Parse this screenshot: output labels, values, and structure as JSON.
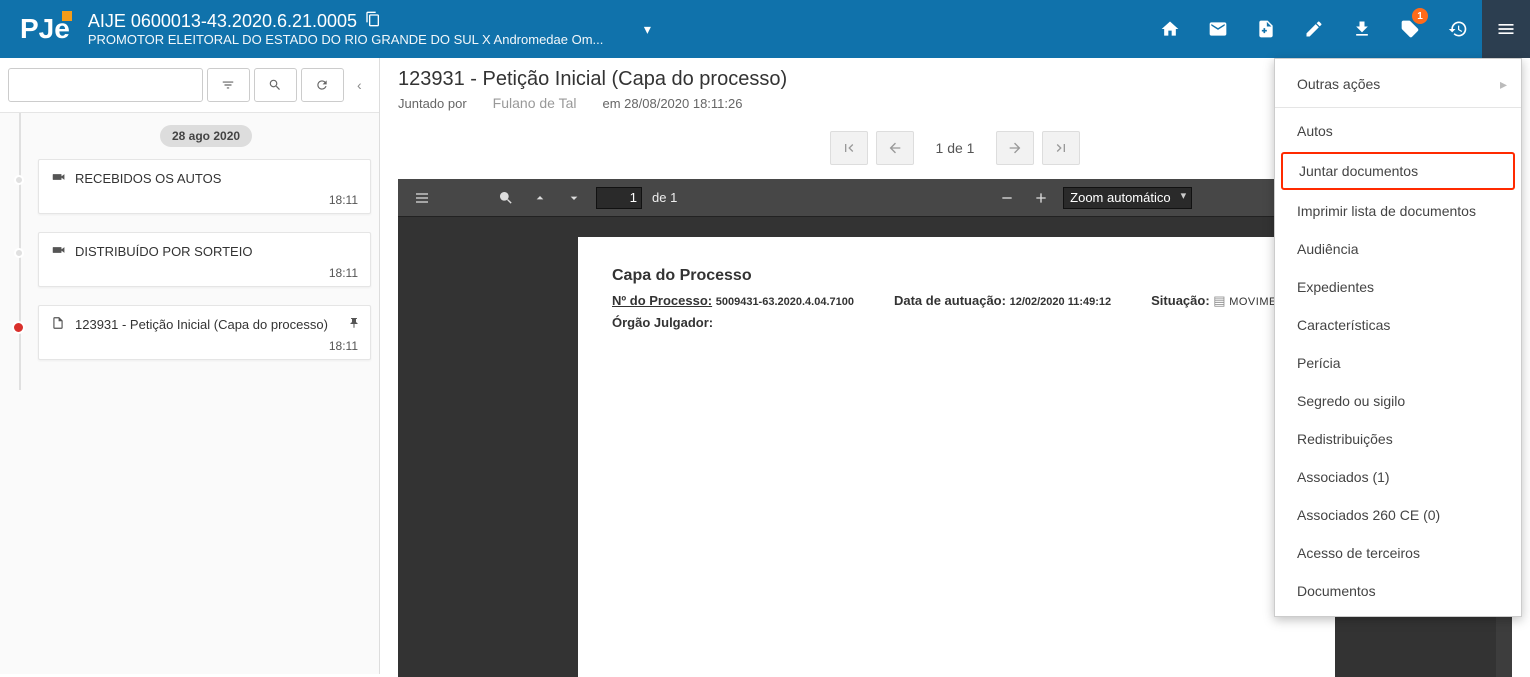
{
  "header": {
    "logo_text": "PJe",
    "case_title": "AIJE 0600013-43.2020.6.21.0005",
    "case_subtitle": "PROMOTOR ELEITORAL DO ESTADO DO RIO GRANDE DO SUL X Andromedae Om...",
    "badge_count": "1"
  },
  "sidebar": {
    "search_placeholder": "",
    "date_chip": "28 ago 2020",
    "items": [
      {
        "icon": "megaphone",
        "label": "RECEBIDOS OS AUTOS",
        "time": "18:11",
        "dot": "gray"
      },
      {
        "icon": "megaphone",
        "label": "DISTRIBUÍDO POR SORTEIO",
        "time": "18:11",
        "dot": "gray"
      },
      {
        "icon": "file",
        "label": "123931 - Petição Inicial (Capa do processo)",
        "time": "18:11",
        "dot": "red",
        "pinned": true
      }
    ]
  },
  "document": {
    "title": "123931 - Petição Inicial (Capa do processo)",
    "joined_by_label": "Juntado por",
    "author": "Fulano de Tal",
    "date_prefix": "em",
    "date": "28/08/2020 18:11:26"
  },
  "pager": {
    "text": "1 de 1"
  },
  "pdf_toolbar": {
    "page_current": "1",
    "page_total": "de 1",
    "zoom": "Zoom automático"
  },
  "pdf_content": {
    "heading": "Capa do Processo",
    "num_label": "Nº do Processo:",
    "num_value": "5009431-63.2020.4.04.7100",
    "date_label": "Data de autuação:",
    "date_value": "12/02/2020 11:49:12",
    "status_label": "Situação:",
    "status_value": "MOVIMENTO",
    "org_label": "Órgão Julgador:"
  },
  "dropdown": {
    "items": [
      {
        "label": "Outras ações",
        "type": "sub"
      },
      {
        "type": "sep"
      },
      {
        "label": "Autos"
      },
      {
        "label": "Juntar documentos",
        "highlight": true
      },
      {
        "label": "Imprimir lista de documentos"
      },
      {
        "label": "Audiência"
      },
      {
        "label": "Expedientes"
      },
      {
        "label": "Características"
      },
      {
        "label": "Perícia"
      },
      {
        "label": "Segredo ou sigilo"
      },
      {
        "label": "Redistribuições"
      },
      {
        "label": "Associados (1)"
      },
      {
        "label": "Associados 260 CE (0)"
      },
      {
        "label": "Acesso de terceiros"
      },
      {
        "label": "Documentos"
      }
    ]
  }
}
